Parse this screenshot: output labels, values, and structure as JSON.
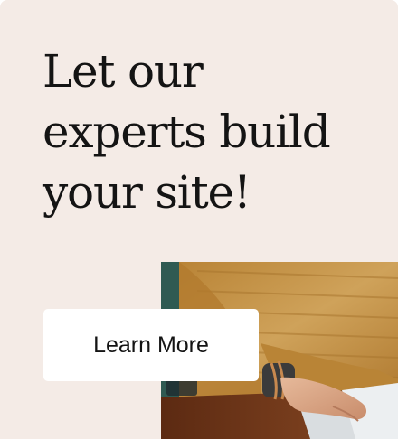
{
  "promo": {
    "headline": "Let our experts build your site!",
    "cta_label": "Learn More",
    "photo_subject": "person-typing-on-laptop"
  },
  "colors": {
    "background": "#f4ebe6",
    "text": "#141414",
    "button_bg": "#ffffff",
    "sweater": "#c99a52",
    "desk": "#7a3e1e"
  }
}
